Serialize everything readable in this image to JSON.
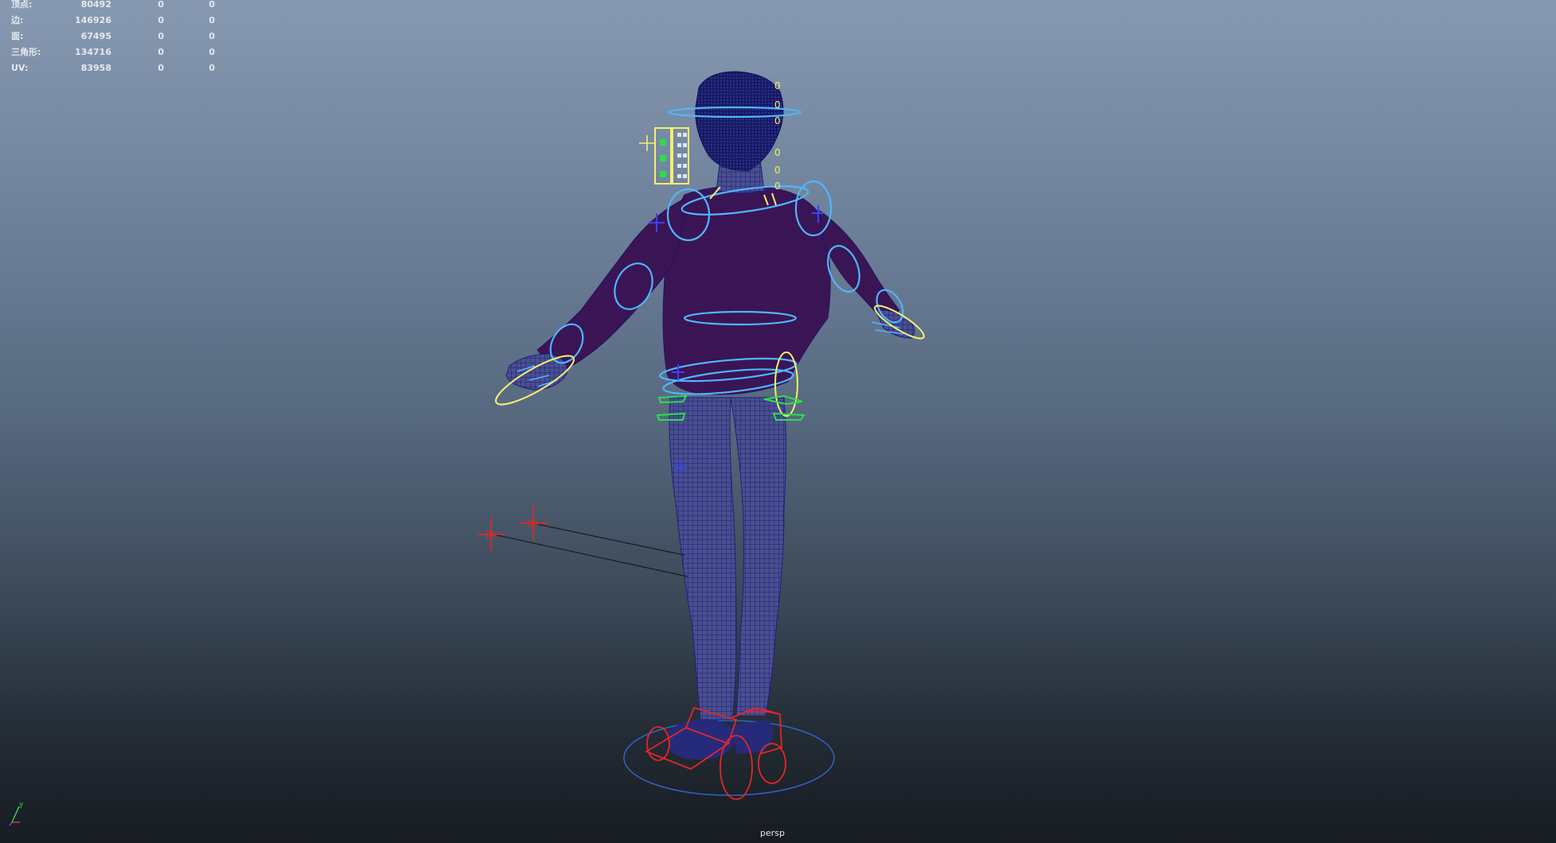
{
  "hud": {
    "rows": [
      {
        "label": "顶点:",
        "value": "80492",
        "selected": "0",
        "triangles": "0"
      },
      {
        "label": "边:",
        "value": "146926",
        "selected": "0",
        "triangles": "0"
      },
      {
        "label": "面:",
        "value": "67495",
        "selected": "0",
        "triangles": "0"
      },
      {
        "label": "三角形:",
        "value": "134716",
        "selected": "0",
        "triangles": "0"
      },
      {
        "label": "UV:",
        "value": "83958",
        "selected": "0",
        "triangles": "0"
      }
    ]
  },
  "viewport": {
    "camera_label": "persp",
    "axis_label": "y"
  },
  "scene": {
    "character": "rigged-character-t-pose",
    "colors": {
      "mesh_wire": "#2b2fa8",
      "shirt": "#3b1350",
      "control_curve": "#4fb6ff",
      "ik_curve": "#f3f06e",
      "pivot_curve": "#2cde4c",
      "foot_ctrl": "#e52626",
      "ground_ring": "#2e64c6"
    },
    "face_controls": [
      "0",
      "0",
      "0",
      "0",
      "0",
      "0"
    ]
  }
}
